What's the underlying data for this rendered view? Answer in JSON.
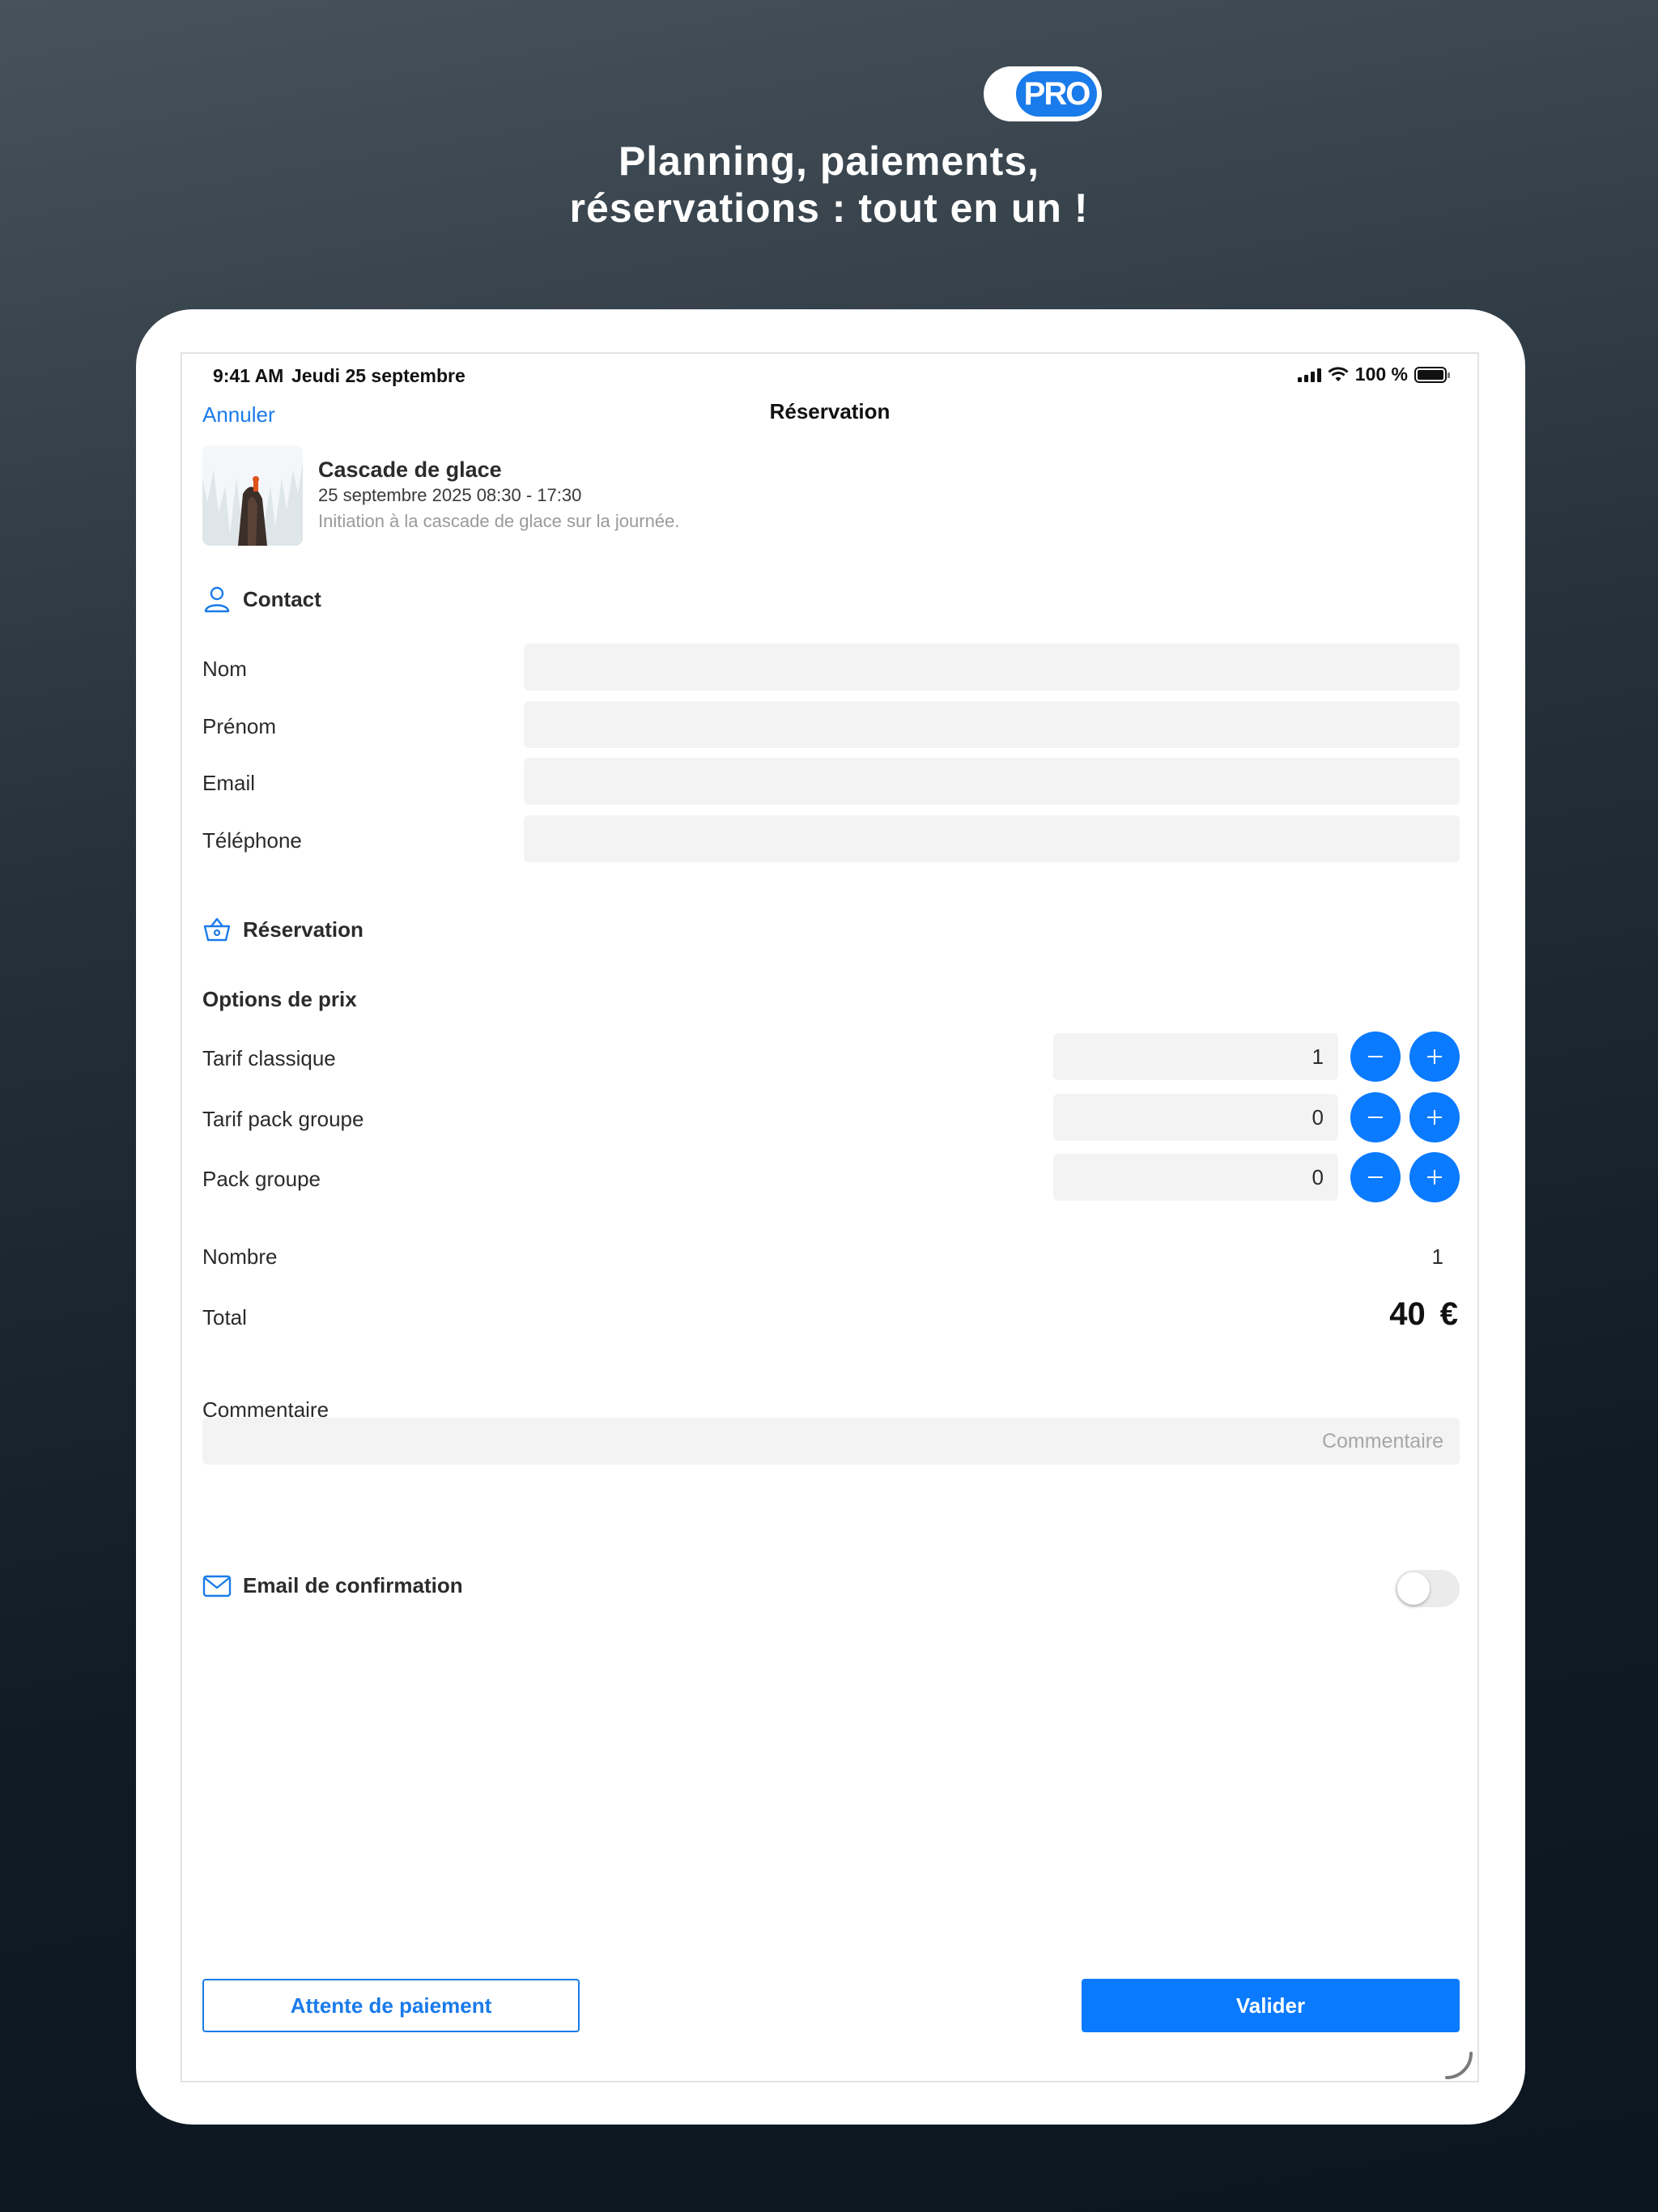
{
  "promo": {
    "badge": "PRO",
    "headline_line1": "Planning, paiements,",
    "headline_line2": "réservations : tout en un !"
  },
  "status_bar": {
    "time": "9:41 AM",
    "date": "Jeudi 25 septembre",
    "battery": "100 %"
  },
  "nav": {
    "cancel": "Annuler",
    "title": "Réservation"
  },
  "event": {
    "title": "Cascade de glace",
    "date": "25 septembre 2025 08:30 - 17:30",
    "description": "Initiation à la cascade de glace sur la journée."
  },
  "contact": {
    "heading": "Contact",
    "fields": [
      {
        "label": "Nom",
        "value": ""
      },
      {
        "label": "Prénom",
        "value": ""
      },
      {
        "label": "Email",
        "value": ""
      },
      {
        "label": "Téléphone",
        "value": ""
      }
    ]
  },
  "reservation": {
    "heading": "Réservation",
    "price_options_heading": "Options de prix",
    "options": [
      {
        "label": "Tarif classique",
        "quantity": "1"
      },
      {
        "label": "Tarif pack groupe",
        "quantity": "0"
      },
      {
        "label": "Pack groupe",
        "quantity": "0"
      }
    ],
    "count_label": "Nombre",
    "count_value": "1",
    "total_label": "Total",
    "total_value": "40",
    "currency": "€"
  },
  "comment": {
    "label": "Commentaire",
    "placeholder": "Commentaire"
  },
  "confirmation": {
    "label": "Email de confirmation",
    "enabled": false
  },
  "actions": {
    "pending": "Attente de paiement",
    "submit": "Valider"
  },
  "colors": {
    "accent": "#0a7aff",
    "input_bg": "#f3f3f3"
  }
}
